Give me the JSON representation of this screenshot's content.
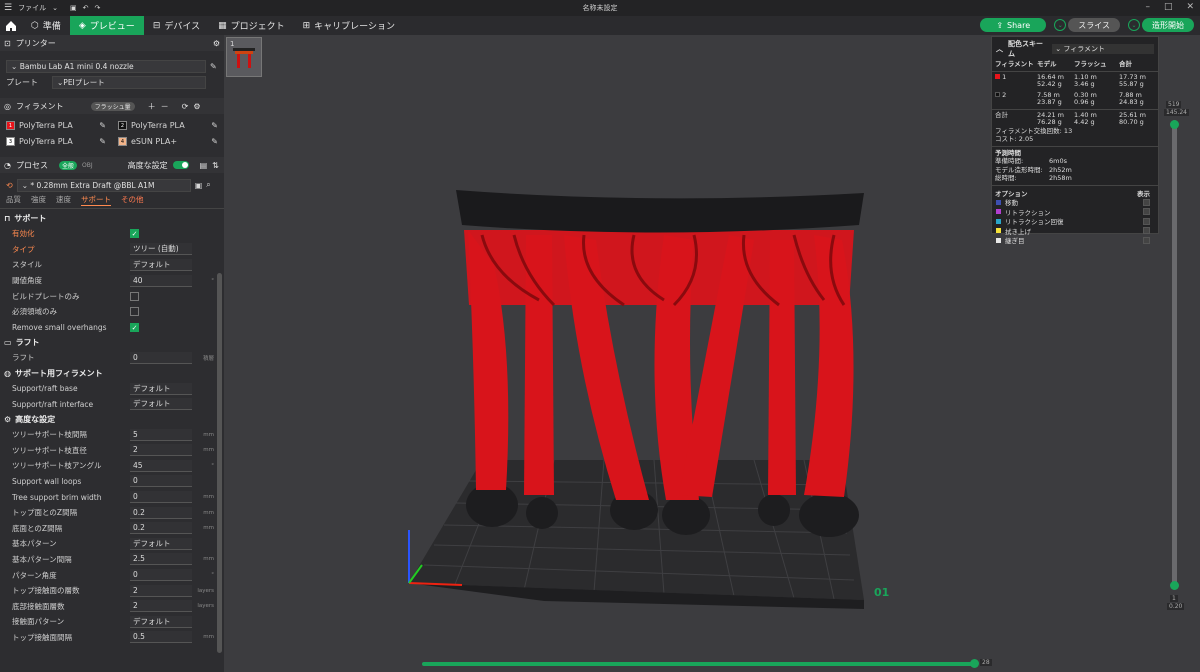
{
  "titlebar": {
    "menu": "ファイル",
    "title": "名称未設定"
  },
  "toolbar": {
    "tabs": [
      {
        "label": "準備"
      },
      {
        "label": "プレビュー"
      },
      {
        "label": "デバイス"
      },
      {
        "label": "プロジェクト"
      },
      {
        "label": "キャリブレーション"
      }
    ],
    "share": "Share",
    "slice": "スライス",
    "print": "造形開始"
  },
  "sidebar": {
    "printer_title": "プリンター",
    "printer_name": "Bambu Lab A1 mini 0.4 nozzle",
    "plate_label": "プレート",
    "plate_value": "PEIプレート",
    "filament_title": "フィラメント",
    "flush_label": "フラッシュ量",
    "filaments": [
      {
        "num": "1",
        "name": "PolyTerra PLA",
        "color": "#e8141b"
      },
      {
        "num": "2",
        "name": "PolyTerra PLA",
        "color": "#111111"
      },
      {
        "num": "3",
        "name": "PolyTerra PLA",
        "color": "#ffffff"
      },
      {
        "num": "4",
        "name": "eSUN PLA+",
        "color": "#f2b48a"
      }
    ],
    "process_title": "プロセス",
    "process_toggle": "全般",
    "process_obj": "OBJ",
    "advanced_label": "高度な設定",
    "process_preset": "* 0.28mm Extra Draft @BBL A1M",
    "subtabs": [
      "品質",
      "強度",
      "速度",
      "サポート",
      "その他"
    ],
    "groups": {
      "support": "サポート",
      "raft": "ラフト",
      "filament_support": "サポート用フィラメント",
      "advanced": "高度な設定"
    },
    "support_rows": [
      {
        "label": "有効化",
        "type": "check",
        "checked": true
      },
      {
        "label": "タイプ",
        "value": "ツリー (自動)"
      },
      {
        "label": "スタイル",
        "value": "デフォルト"
      },
      {
        "label": "閾値角度",
        "value": "40",
        "unit": "°"
      },
      {
        "label": "ビルドプレートのみ",
        "type": "check",
        "checked": false
      },
      {
        "label": "必須領域のみ",
        "type": "check",
        "checked": false
      },
      {
        "label": "Remove small overhangs",
        "type": "check",
        "checked": true
      }
    ],
    "raft_rows": [
      {
        "label": "ラフト",
        "value": "0",
        "unit": "積層"
      }
    ],
    "filament_rows": [
      {
        "label": "Support/raft base",
        "value": "デフォルト"
      },
      {
        "label": "Support/raft interface",
        "value": "デフォルト"
      }
    ],
    "advanced_rows": [
      {
        "label": "ツリーサポート枝間隔",
        "value": "5",
        "unit": "mm"
      },
      {
        "label": "ツリーサポート枝直径",
        "value": "2",
        "unit": "mm"
      },
      {
        "label": "ツリーサポート枝アングル",
        "value": "45",
        "unit": "°"
      },
      {
        "label": "Support wall loops",
        "value": "0"
      },
      {
        "label": "Tree support brim width",
        "value": "0",
        "unit": "mm"
      },
      {
        "label": "トップ面とのZ間隔",
        "value": "0.2",
        "unit": "mm"
      },
      {
        "label": "底面とのZ間隔",
        "value": "0.2",
        "unit": "mm"
      },
      {
        "label": "基本パターン",
        "value": "デフォルト"
      },
      {
        "label": "基本パターン間隔",
        "value": "2.5",
        "unit": "mm"
      },
      {
        "label": "パターン角度",
        "value": "0",
        "unit": "°"
      },
      {
        "label": "トップ接触面の層数",
        "value": "2",
        "unit": "layers"
      },
      {
        "label": "底部接触面層数",
        "value": "2",
        "unit": "layers"
      },
      {
        "label": "接触面パターン",
        "value": "デフォルト"
      },
      {
        "label": "トップ接触面間隔",
        "value": "0.5",
        "unit": "mm"
      }
    ]
  },
  "viewport": {
    "plate_number": "1",
    "plate_label": "01",
    "top_layer_top": "519",
    "top_layer_bottom": "145.24",
    "bottom_layer_top": "1",
    "bottom_layer_bottom": "0.20",
    "h_slider_value": "28"
  },
  "stats": {
    "title": "配色スキーム",
    "scheme": "フィラメント",
    "headers": [
      "フィラメント",
      "モデル",
      "フラッシュ",
      "合計"
    ],
    "rows": [
      {
        "id": "1",
        "color": "#e8141b",
        "model_m": "16.64 m",
        "model_g": "52.42 g",
        "flush_m": "1.10 m",
        "flush_g": "3.46 g",
        "total_m": "17.73 m",
        "total_g": "55.87 g"
      },
      {
        "id": "2",
        "color": "#111111",
        "model_m": "7.58 m",
        "model_g": "23.87 g",
        "flush_m": "0.30 m",
        "flush_g": "0.96 g",
        "total_m": "7.88 m",
        "total_g": "24.83 g"
      }
    ],
    "sum_label": "合計",
    "sum_model_m": "24.21 m",
    "sum_model_g": "76.28 g",
    "sum_flush_m": "1.40 m",
    "sum_flush_g": "4.42 g",
    "sum_total_m": "25.61 m",
    "sum_total_g": "80.70 g",
    "changes": "フィラメント交換回数: 13",
    "cost": "コスト: 2.05",
    "time_title": "予測時間",
    "prep_label": "準備時間:",
    "prep_value": "6m0s",
    "model_label": "モデル造形時間:",
    "model_value": "2h52m",
    "total_label": "総時間:",
    "total_value": "2h58m",
    "option_title": "オプション",
    "show_title": "表示",
    "options": [
      {
        "label": "移動",
        "color": "#3d4fb0"
      },
      {
        "label": "リトラクション",
        "color": "#b23fd0"
      },
      {
        "label": "リトラクション回復",
        "color": "#2aa6c8"
      },
      {
        "label": "拭き上げ",
        "color": "#f5e23a"
      },
      {
        "label": "継ぎ目",
        "color": "#e8e8e8"
      }
    ]
  }
}
